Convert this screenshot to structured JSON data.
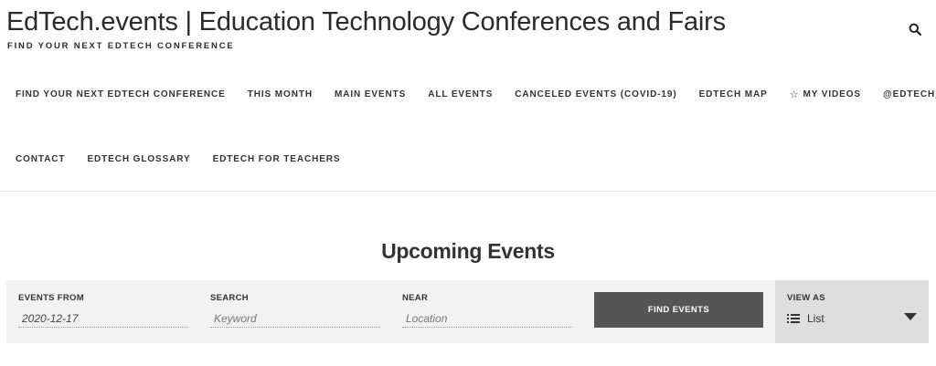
{
  "header": {
    "site_title": "EdTech.events | Education Technology Conferences and Fairs",
    "tagline": "FIND YOUR NEXT EDTECH CONFERENCE",
    "search_icon": "search-icon"
  },
  "nav": {
    "row1": [
      {
        "label": "FIND YOUR NEXT EDTECH CONFERENCE"
      },
      {
        "label": "THIS MONTH"
      },
      {
        "label": "MAIN EVENTS"
      },
      {
        "label": "ALL EVENTS"
      },
      {
        "label": "CANCELED EVENTS (COVID-19)"
      },
      {
        "label": "EDTECH MAP"
      },
      {
        "label": "MY VIDEOS",
        "icon": "star-icon",
        "icon_glyph": "☆"
      },
      {
        "label": "@EDTECH_EVENTS"
      }
    ],
    "row2": [
      {
        "label": "CONTACT"
      },
      {
        "label": "EDTECH GLOSSARY"
      },
      {
        "label": "EDTECH FOR TEACHERS"
      }
    ]
  },
  "events": {
    "title": "Upcoming Events"
  },
  "filters": {
    "events_from": {
      "label": "EVENTS FROM",
      "value": "2020-12-17"
    },
    "search": {
      "label": "SEARCH",
      "placeholder": "Keyword"
    },
    "near": {
      "label": "NEAR",
      "placeholder": "Location"
    },
    "find_button": "FIND EVENTS",
    "view_as": {
      "label": "VIEW AS",
      "value": "List",
      "icon": "list-icon"
    }
  },
  "colors": {
    "filter_bar_bg": "#f2f2f2",
    "button_bg": "#555555",
    "view_as_bg": "#dedede",
    "text": "#333333"
  }
}
